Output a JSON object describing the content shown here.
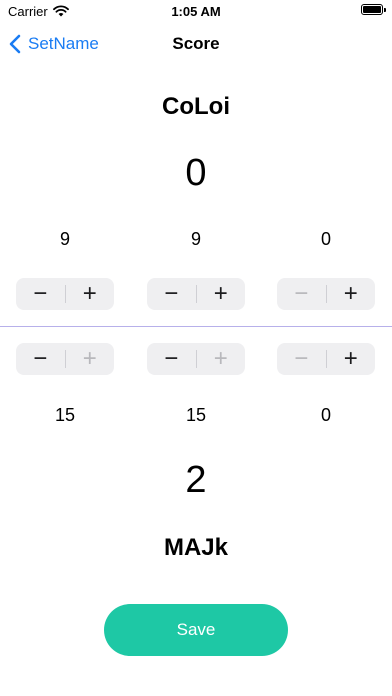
{
  "status_bar": {
    "carrier": "Carrier",
    "time": "1:05 AM",
    "battery_level": 1.0
  },
  "nav": {
    "back_label": "SetName",
    "title": "Score"
  },
  "colors": {
    "accent_blue": "#1a7cf3",
    "save_green": "#1ec8a5",
    "divider_purple": "#b7b0ea",
    "stepper_bg": "#efeff1"
  },
  "player_top": {
    "name": "CoLoi",
    "total": "0",
    "scores": [
      "9",
      "9",
      "0"
    ],
    "steppers": [
      {
        "minus": "−",
        "plus": "+",
        "minus_disabled": false,
        "plus_disabled": false
      },
      {
        "minus": "−",
        "plus": "+",
        "minus_disabled": false,
        "plus_disabled": false
      },
      {
        "minus": "−",
        "plus": "+",
        "minus_disabled": true,
        "plus_disabled": false
      }
    ]
  },
  "player_bottom": {
    "name": "MAJk",
    "total": "2",
    "scores": [
      "15",
      "15",
      "0"
    ],
    "steppers": [
      {
        "minus": "−",
        "plus": "+",
        "minus_disabled": false,
        "plus_disabled": true
      },
      {
        "minus": "−",
        "plus": "+",
        "minus_disabled": false,
        "plus_disabled": true
      },
      {
        "minus": "−",
        "plus": "+",
        "minus_disabled": true,
        "plus_disabled": false
      }
    ]
  },
  "save_label": "Save"
}
